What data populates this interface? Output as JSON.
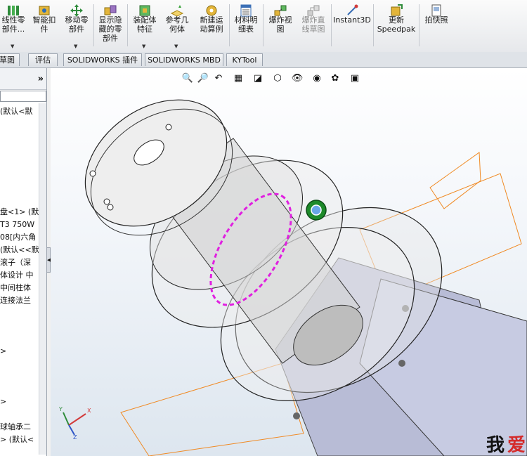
{
  "toolbar": {
    "items": [
      {
        "label": "线性零\n部件...",
        "icon": "linear-pattern-icon",
        "color": "#2e8b3a"
      },
      {
        "label": "智能扣\n件",
        "icon": "smart-fastener-icon",
        "color": "#c79a1d"
      },
      {
        "label": "移动零\n部件",
        "icon": "move-component-icon",
        "color": "#2e8b3a"
      },
      {
        "label": "显示隐\n藏的零\n部件",
        "icon": "show-hidden-icon",
        "color": "#7a4fa0"
      },
      {
        "label": "装配体\n特征",
        "icon": "assembly-feature-icon",
        "color": "#2e8b3a"
      },
      {
        "label": "参考几\n何体",
        "icon": "reference-geometry-icon",
        "color": "#d4a017"
      },
      {
        "label": "新建运\n动算例",
        "icon": "motion-study-icon",
        "color": "#c79a1d"
      },
      {
        "label": "材料明\n细表",
        "icon": "bom-icon",
        "color": "#3b6fb6"
      },
      {
        "label": "爆炸视\n图",
        "icon": "exploded-view-icon",
        "color": "#c79a1d"
      },
      {
        "label": "爆炸直\n线草图",
        "icon": "explode-line-sketch-icon",
        "color": "#9a9a9a"
      },
      {
        "label": "Instant3D",
        "icon": "instant3d-icon",
        "color": "#d23b3b"
      },
      {
        "label": "更新\nSpeedpak",
        "icon": "speedpak-icon",
        "color": "#c79a1d"
      },
      {
        "label": "拍快照",
        "icon": "snapshot-icon",
        "color": "#555555"
      }
    ]
  },
  "tabs": [
    {
      "label": "草图"
    },
    {
      "label": "评估"
    },
    {
      "label": "SOLIDWORKS 插件"
    },
    {
      "label": "SOLIDWORKS MBD"
    },
    {
      "label": "KYTool"
    }
  ],
  "tree": {
    "collapse_label": "»",
    "items": [
      {
        "label": "(默认<默"
      },
      {
        "label": "盘<1> (默"
      },
      {
        "label": "T3 750W"
      },
      {
        "label": "08[内六角"
      },
      {
        "label": "(默认<<默"
      },
      {
        "label": "滚子（深"
      },
      {
        "label": "体设计 中"
      },
      {
        "label": "中间柱体"
      },
      {
        "label": "连接法兰"
      },
      {
        "label": ">"
      },
      {
        "label": ">"
      },
      {
        "label": "球轴承二"
      },
      {
        "label": "> (默认<"
      }
    ]
  },
  "viewport": {
    "triad": {
      "x": "X",
      "y": "Y",
      "z": "Z"
    },
    "watermark": {
      "text1": "我",
      "text2": "爱"
    },
    "colors": {
      "selection": "#e020e0",
      "orange_plane": "#f08a24",
      "housing": "#b8bcd6"
    }
  }
}
